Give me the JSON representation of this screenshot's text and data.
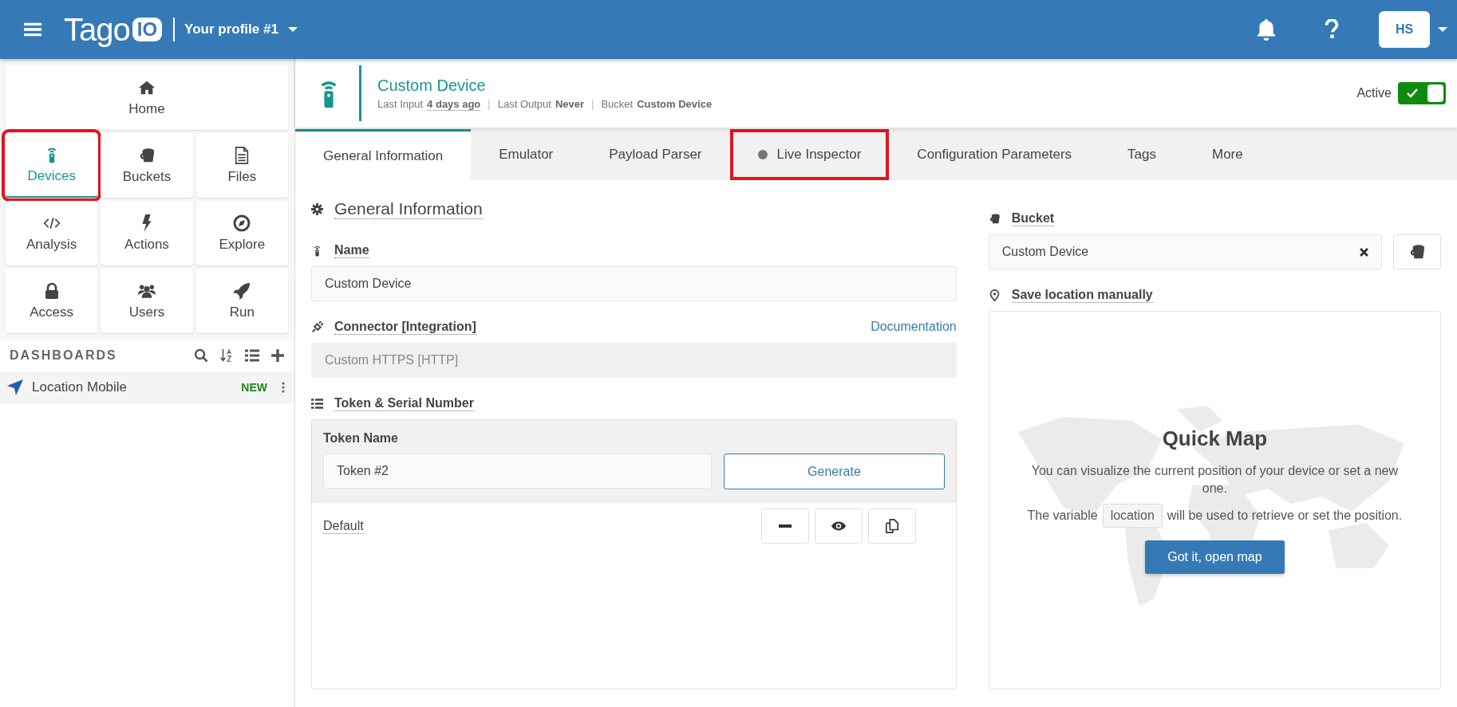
{
  "header": {
    "brand_text": "Tago",
    "brand_mark": "IO",
    "profile": "Your profile #1",
    "avatar": "HS"
  },
  "sidebar": {
    "nav": [
      {
        "label": "Home",
        "kind": "home",
        "selected": false,
        "highlighted": false
      },
      {
        "label": "Devices",
        "kind": "devices",
        "selected": true,
        "highlighted": true
      },
      {
        "label": "Buckets",
        "kind": "buckets",
        "selected": false,
        "highlighted": false
      },
      {
        "label": "Files",
        "kind": "files",
        "selected": false,
        "highlighted": false
      },
      {
        "label": "Analysis",
        "kind": "analysis",
        "selected": false,
        "highlighted": false
      },
      {
        "label": "Actions",
        "kind": "actions",
        "selected": false,
        "highlighted": false
      },
      {
        "label": "Explore",
        "kind": "explore",
        "selected": false,
        "highlighted": false
      },
      {
        "label": "Access",
        "kind": "access",
        "selected": false,
        "highlighted": false
      },
      {
        "label": "Users",
        "kind": "users",
        "selected": false,
        "highlighted": false
      },
      {
        "label": "Run",
        "kind": "run",
        "selected": false,
        "highlighted": false
      }
    ],
    "dashboards": {
      "title": "DASHBOARDS",
      "items": [
        {
          "label": "Location Mobile",
          "badge": "NEW"
        }
      ]
    }
  },
  "device": {
    "name": "Custom Device",
    "meta": [
      {
        "label": "Last Input",
        "value": "4 days ago",
        "underlined": true
      },
      {
        "label": "Last Output",
        "value": "Never",
        "underlined": false,
        "separator": "|"
      },
      {
        "label": "Bucket",
        "value": "Custom Device",
        "underlined": false,
        "separator": "|"
      }
    ],
    "active_label": "Active",
    "active": true
  },
  "tabs": [
    {
      "label": "General Information",
      "selected": true,
      "highlighted": false,
      "dot": false
    },
    {
      "label": "Emulator",
      "selected": false,
      "highlighted": false,
      "dot": false
    },
    {
      "label": "Payload Parser",
      "selected": false,
      "highlighted": false,
      "dot": false
    },
    {
      "label": "Live Inspector",
      "selected": false,
      "highlighted": true,
      "dot": true
    },
    {
      "label": "Configuration Parameters",
      "selected": false,
      "highlighted": false,
      "dot": false
    },
    {
      "label": "Tags",
      "selected": false,
      "highlighted": false,
      "dot": false
    },
    {
      "label": "More",
      "selected": false,
      "highlighted": false,
      "dot": false
    }
  ],
  "general": {
    "title": "General Information",
    "name_label": "Name",
    "name_value": "Custom Device",
    "connector_label": "Connector [Integration]",
    "documentation": "Documentation",
    "connector_value": "Custom HTTPS [HTTP]",
    "token_section": "Token & Serial Number",
    "token_name_label": "Token Name",
    "token_name_value": "Token #2",
    "generate": "Generate",
    "tokens": [
      {
        "name": "Default"
      }
    ]
  },
  "bucket": {
    "label": "Bucket",
    "value": "Custom Device"
  },
  "location": {
    "title": "Save location manually",
    "map_title": "Quick Map",
    "text1": "You can visualize the current position of your device or set a new one.",
    "text2_before": "The variable",
    "variable": "location",
    "text2_after": "will be used to retrieve or set the position.",
    "button": "Got it, open map"
  }
}
